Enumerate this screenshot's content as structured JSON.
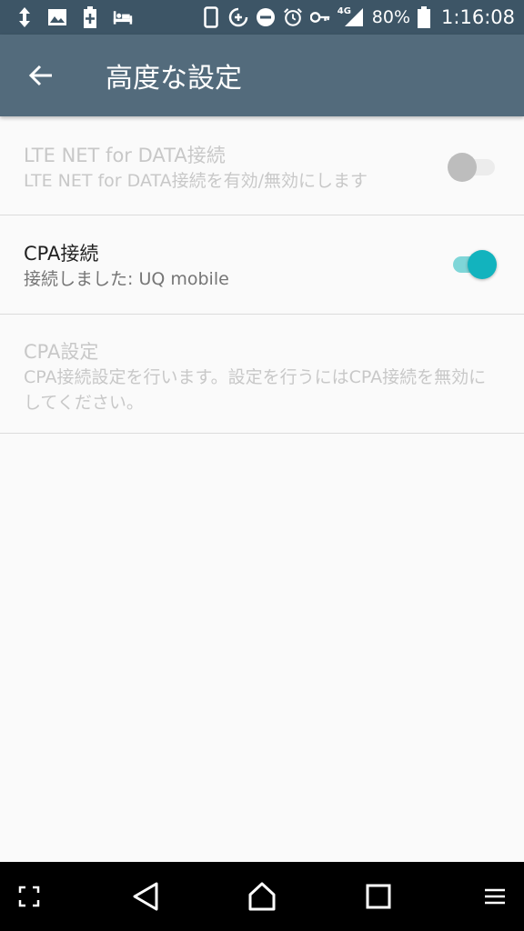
{
  "status_bar": {
    "battery_percent": "80%",
    "time": "1:16:08",
    "network_type": "4G",
    "icons": [
      "data-transfer-icon",
      "image-icon",
      "battery-plus-icon",
      "bed-icon",
      "phone-icon",
      "data-saver-icon",
      "do-not-disturb-icon",
      "alarm-icon",
      "vpn-key-icon",
      "signal-icon",
      "battery-icon"
    ]
  },
  "app_bar": {
    "title": "高度な設定",
    "back_icon": "arrow-back-icon"
  },
  "settings": [
    {
      "title": "LTE NET for DATA接続",
      "summary": "LTE NET for DATA接続を有効/無効にします",
      "enabled": false,
      "switch_on": false
    },
    {
      "title": "CPA接続",
      "summary": "接続しました: UQ mobile",
      "enabled": true,
      "switch_on": true
    },
    {
      "title": "CPA設定",
      "summary": "CPA接続設定を行います。設定を行うにはCPA接続を無効にしてください。",
      "enabled": false
    }
  ],
  "nav_bar": {
    "icons": [
      "screenshot-frame-icon",
      "back-triangle-icon",
      "home-icon",
      "recents-icon",
      "menu-icon"
    ]
  },
  "colors": {
    "status_bar": "#3d5566",
    "app_bar": "#536b7c",
    "accent": "#12b3be",
    "background": "#fafafa"
  }
}
